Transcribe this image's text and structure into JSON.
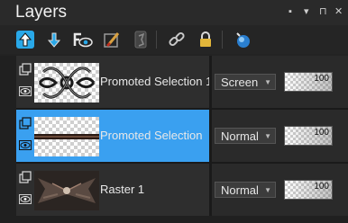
{
  "panel": {
    "title": "Layers",
    "buttons": {
      "dock": "▪",
      "menu": "▾",
      "pin": "⊓",
      "close": "✕"
    }
  },
  "toolbar": {
    "tools": [
      "move-layer-up-icon",
      "move-layer-down-icon",
      "visibility-toggle-icon",
      "brush-icon",
      "mask-icon",
      "link-icon",
      "lock-icon",
      "sphere-icon"
    ]
  },
  "layers": [
    {
      "name": "Promoted Selection 1",
      "blend_mode": "Screen",
      "opacity": "100",
      "selected": false
    },
    {
      "name": "Promoted Selection",
      "blend_mode": "Normal",
      "opacity": "100",
      "selected": true
    },
    {
      "name": "Raster 1",
      "blend_mode": "Normal",
      "opacity": "100",
      "selected": false
    }
  ],
  "colors": {
    "panel_bg": "#232323",
    "selected_row": "#3aa0f0",
    "toolbar_up_arrow": "#29a8e8"
  }
}
